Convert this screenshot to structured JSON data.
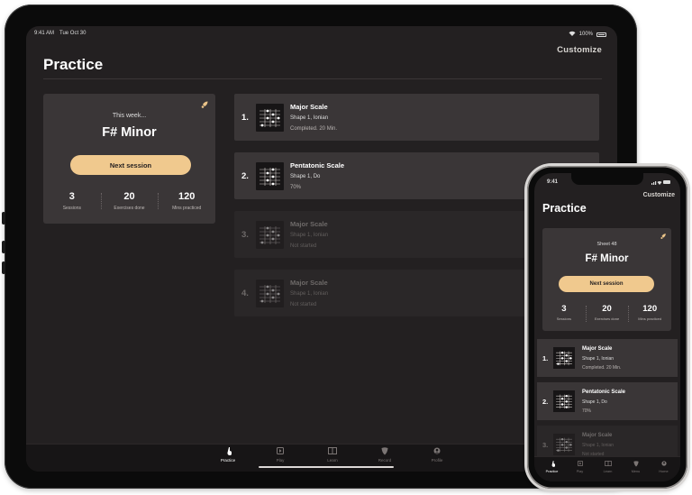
{
  "ipad": {
    "status": {
      "time": "9:41 AM",
      "date": "Tue Oct 30",
      "battery": "100%"
    },
    "customize_label": "Customize",
    "title": "Practice",
    "card": {
      "caption": "This week...",
      "key": "F# Minor",
      "next_label": "Next session",
      "stats": [
        {
          "value": "3",
          "label": "Sessions"
        },
        {
          "value": "20",
          "label": "Exercises done"
        },
        {
          "value": "120",
          "label": "Mins practiced"
        }
      ]
    },
    "exercises": [
      {
        "index": "1.",
        "title": "Major Scale",
        "subtitle": "Shape 1, Ionian",
        "status": "Completed. 20 Min."
      },
      {
        "index": "2.",
        "title": "Pentatonic Scale",
        "subtitle": "Shape 1, Do",
        "status": "70%"
      },
      {
        "index": "3.",
        "title": "Major Scale",
        "subtitle": "Shape 1, Ionian",
        "status": "Not started"
      },
      {
        "index": "4.",
        "title": "Major Scale",
        "subtitle": "Shape 1, Ionian",
        "status": "Not started"
      }
    ],
    "tabs": [
      {
        "label": "Practice",
        "icon": "guitar-icon"
      },
      {
        "label": "Play",
        "icon": "play-icon"
      },
      {
        "label": "Learn",
        "icon": "book-icon"
      },
      {
        "label": "Record",
        "icon": "pick-icon"
      },
      {
        "label": "Profile",
        "icon": "profile-icon"
      }
    ]
  },
  "iphone": {
    "status": {
      "time": "9:41"
    },
    "customize_label": "Customize",
    "title": "Practice",
    "card": {
      "caption": "Sheet 48",
      "key": "F# Minor",
      "next_label": "Next session",
      "stats": [
        {
          "value": "3",
          "label": "Sessions"
        },
        {
          "value": "20",
          "label": "Exercises done"
        },
        {
          "value": "120",
          "label": "Mins practiced"
        }
      ]
    },
    "exercises": [
      {
        "index": "1.",
        "title": "Major Scale",
        "subtitle": "Shape 1, Ionian",
        "status": "Completed. 20 Min."
      },
      {
        "index": "2.",
        "title": "Pentatonic Scale",
        "subtitle": "Shape 1, Do",
        "status": "70%"
      },
      {
        "index": "3.",
        "title": "Major Scale",
        "subtitle": "Shape 1, Ionian",
        "status": "Not started"
      }
    ],
    "tabs": [
      {
        "label": "Practice"
      },
      {
        "label": "Play"
      },
      {
        "label": "Learn"
      },
      {
        "label": "Menu"
      },
      {
        "label": "Home"
      }
    ]
  },
  "colors": {
    "accent": "#f0c98e",
    "background": "#232021",
    "card": "#3a3637",
    "tabbar": "#171516"
  }
}
